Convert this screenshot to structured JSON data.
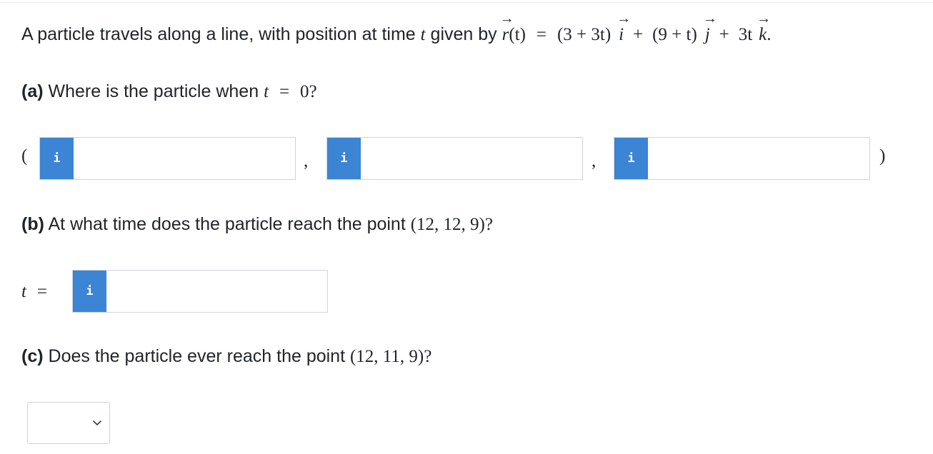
{
  "intro": {
    "text_before": "A particle travels along a line, with position at time",
    "t_var": "t",
    "given_by": "given by",
    "r_vec": "r",
    "r_arg": "(t)",
    "equals": "=",
    "comp1": "(3 + 3t)",
    "i_vec": "i",
    "plus1": "+",
    "comp2": "(9 + t)",
    "j_vec": "j",
    "plus2": "+",
    "comp3": "3t",
    "k_vec": "k",
    "period": "."
  },
  "part_a": {
    "label": "(a)",
    "text": "Where is the particle when",
    "t_var": "t",
    "equals": "=",
    "value": "0?",
    "open_paren": "(",
    "close_paren": ")",
    "comma": ",",
    "info_glyph": "i",
    "fields": [
      {
        "value": "",
        "placeholder": ""
      },
      {
        "value": "",
        "placeholder": ""
      },
      {
        "value": "",
        "placeholder": ""
      }
    ]
  },
  "part_b": {
    "label": "(b)",
    "text": "At what time does the particle reach the point",
    "point": "(12, 12, 9)?",
    "t_var": "t",
    "equals": "=",
    "info_glyph": "i",
    "field": {
      "value": "",
      "placeholder": ""
    }
  },
  "part_c": {
    "label": "(c)",
    "text": "Does the particle ever reach the point",
    "point": "(12, 11, 9)?",
    "select_value": ""
  },
  "colors": {
    "info_button": "#3b85d4",
    "text": "#1f2429",
    "border": "#ced4da"
  },
  "icons": {
    "info": "info-icon",
    "dropdown": "chevron-down-icon"
  }
}
